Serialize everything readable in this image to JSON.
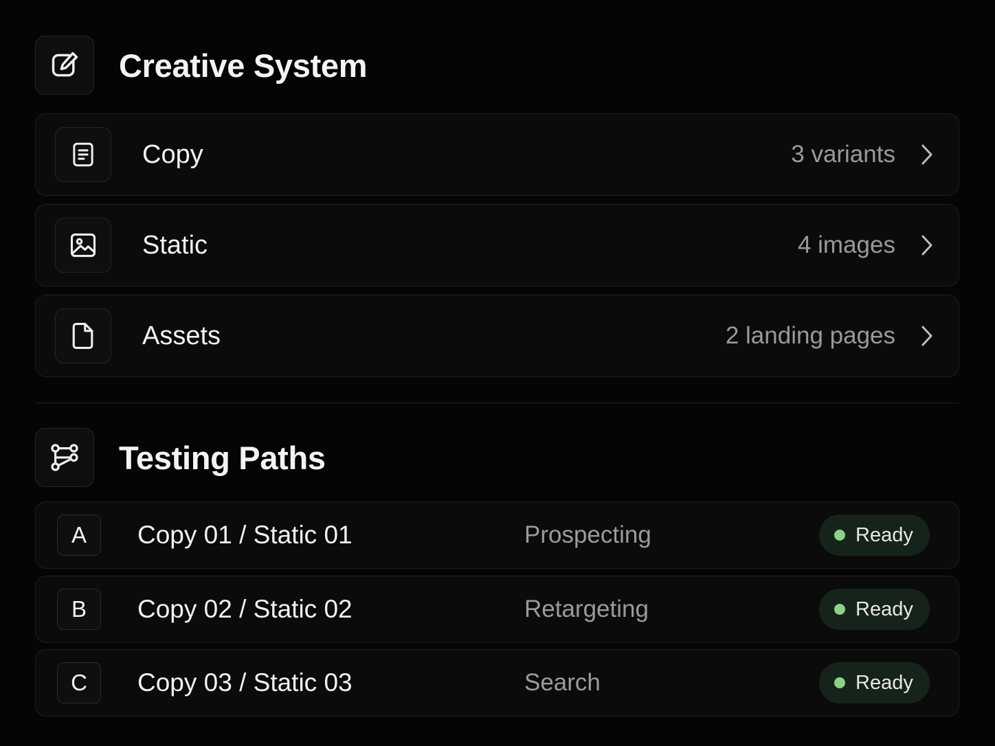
{
  "creative_system": {
    "title": "Creative System",
    "icon": "edit-icon",
    "rows": [
      {
        "label": "Copy",
        "meta": "3 variants",
        "icon": "document-text-icon"
      },
      {
        "label": "Static",
        "meta": "4 images",
        "icon": "image-icon"
      },
      {
        "label": "Assets",
        "meta": "2 landing pages",
        "icon": "file-icon"
      }
    ]
  },
  "testing_paths": {
    "title": "Testing Paths",
    "icon": "branch-icon",
    "rows": [
      {
        "letter": "A",
        "combo": "Copy 01 / Static 01",
        "audience": "Prospecting",
        "status": "Ready"
      },
      {
        "letter": "B",
        "combo": "Copy 02 / Static 02",
        "audience": "Retargeting",
        "status": "Ready"
      },
      {
        "letter": "C",
        "combo": "Copy 03 / Static 03",
        "audience": "Search",
        "status": "Ready"
      }
    ]
  },
  "colors": {
    "background": "#050505",
    "card": "#0b0b0b",
    "status_dot": "#8ed18a",
    "status_pill": "#16231a"
  }
}
